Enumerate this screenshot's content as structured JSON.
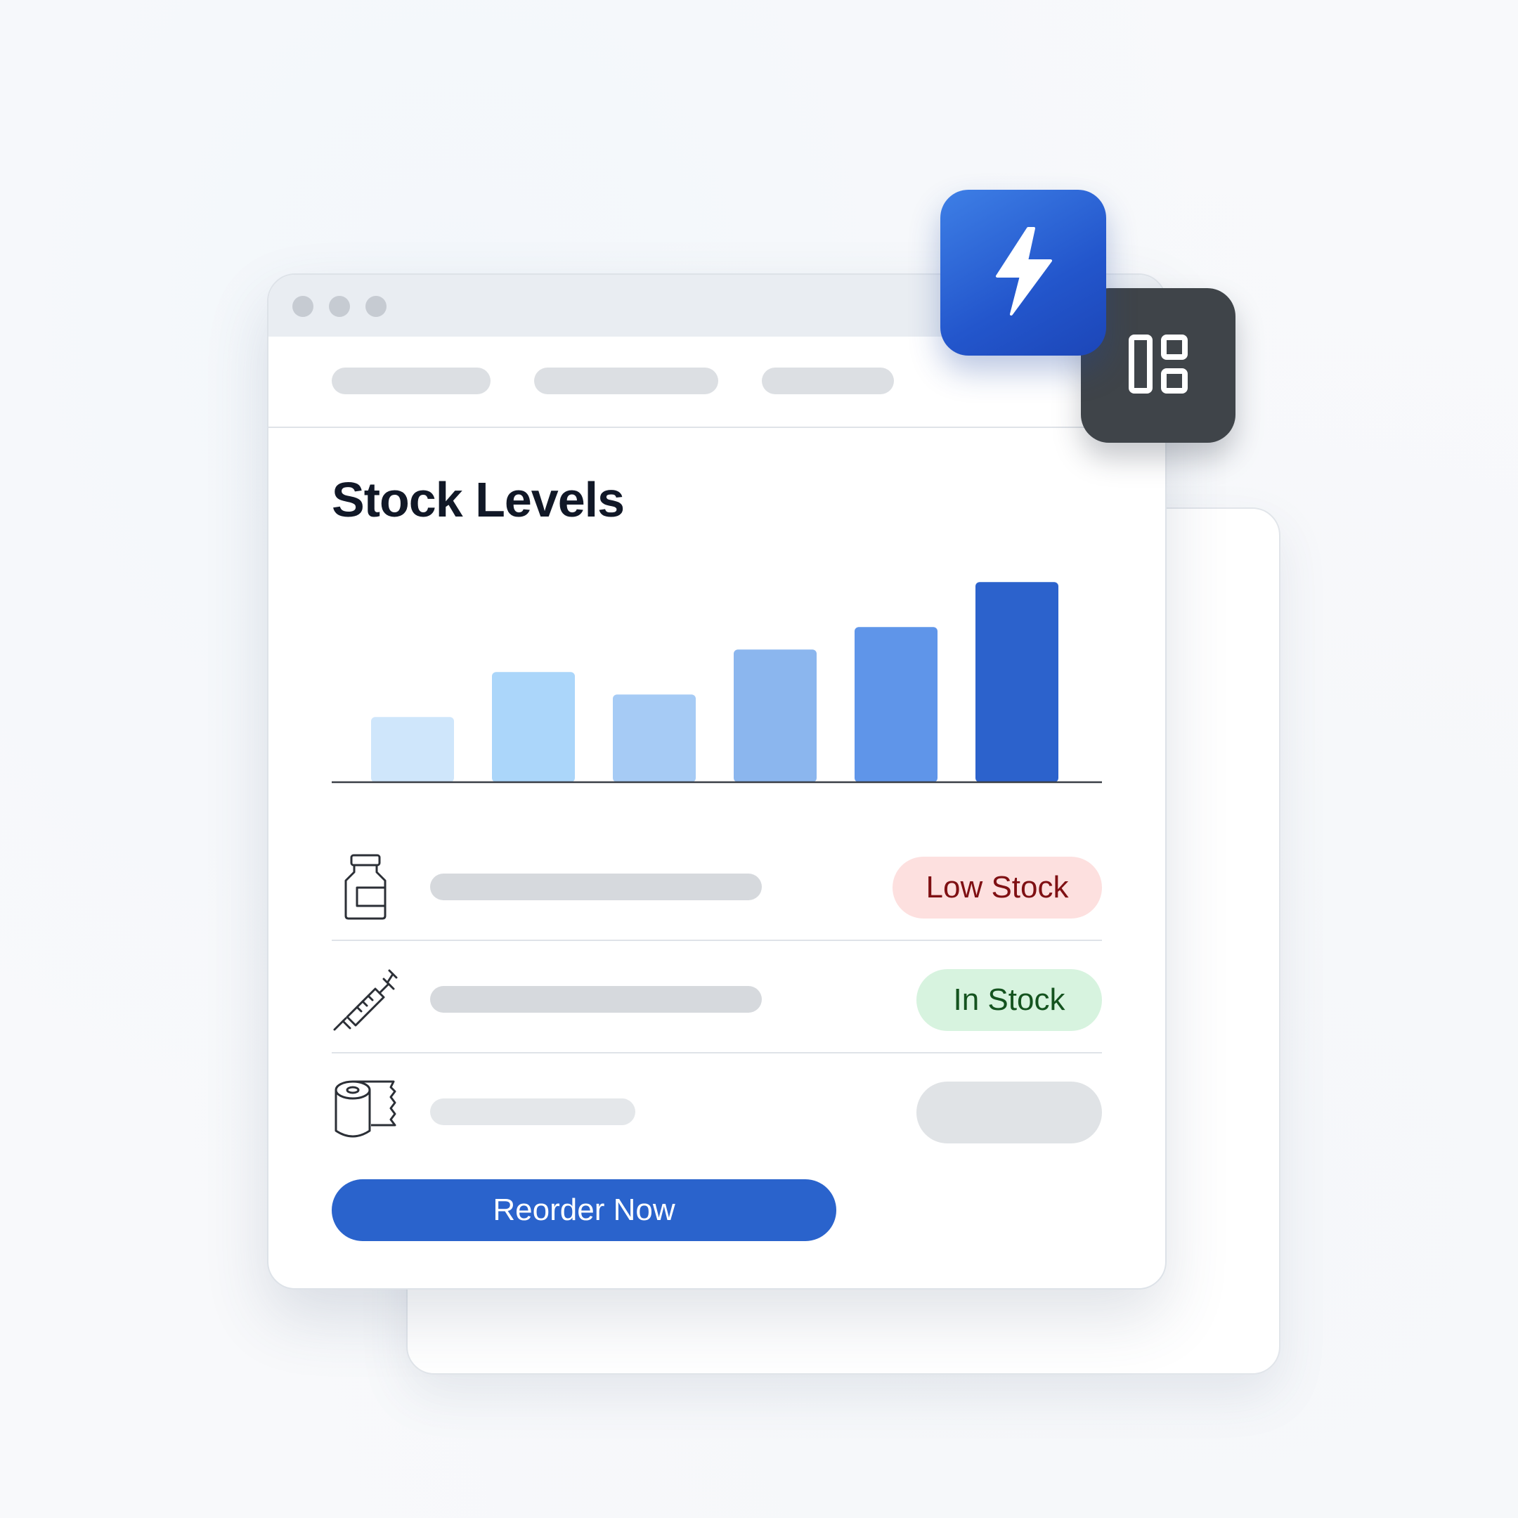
{
  "window": {
    "title": "Stock Levels"
  },
  "chart_data": {
    "type": "bar",
    "categories": [],
    "values": [
      29,
      49,
      39,
      59,
      69,
      89
    ],
    "ylim": [
      0,
      100
    ],
    "colors": [
      "#cfe6fb",
      "#abd6fa",
      "#a6cbf5",
      "#8bb6ee",
      "#5f95e9",
      "#2c62cc"
    ],
    "title": "Stock Levels"
  },
  "inventory": {
    "items": [
      {
        "icon": "medicine-bottle-icon",
        "status": "Low Stock",
        "status_color": "#7f1013",
        "status_bg": "#fde0df"
      },
      {
        "icon": "syringe-icon",
        "status": "In Stock",
        "status_color": "#14531f",
        "status_bg": "#d7f3df"
      },
      {
        "icon": "bandage-roll-icon",
        "status": "",
        "status_bg": "#e0e3e6"
      }
    ]
  },
  "actions": {
    "reorder_label": "Reorder Now"
  },
  "floating_tiles": [
    {
      "icon": "lightning-bolt-icon",
      "color": "#2a5fd2"
    },
    {
      "icon": "layout-grid-icon",
      "color": "#3f4449"
    }
  ],
  "theme": {
    "accent": "#2a63cc"
  }
}
